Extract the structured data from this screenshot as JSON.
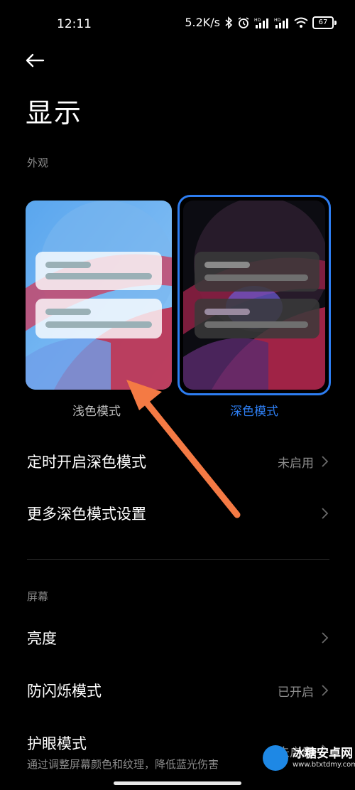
{
  "status_bar": {
    "time": "12:11",
    "net_speed": "5.2K/s",
    "battery": "67",
    "icons": [
      "bluetooth-icon",
      "alarm-icon",
      "signal-hd-icon",
      "signal-hd-icon",
      "wifi-icon",
      "battery-icon"
    ]
  },
  "header": {
    "title": "显示",
    "back_icon": "back-arrow-icon"
  },
  "appearance": {
    "section_label": "外观",
    "light_label": "浅色模式",
    "dark_label": "深色模式",
    "selected": "dark",
    "accent_color": "#2d7df0"
  },
  "rows": {
    "schedule": {
      "label": "定时开启深色模式",
      "value": "未启用"
    },
    "more_dark": {
      "label": "更多深色模式设置"
    }
  },
  "screen": {
    "section_label": "屏幕",
    "brightness": {
      "label": "亮度"
    },
    "anti_flicker": {
      "label": "防闪烁模式",
      "value": "已开启"
    },
    "eye_care": {
      "label": "护眼模式",
      "sub": "通过调整屏幕颜色和纹理，降低蓝光伤害",
      "value": "未启用"
    }
  },
  "watermark": {
    "title": "冰糖安卓网",
    "url": "www.btxtdmy.com"
  }
}
